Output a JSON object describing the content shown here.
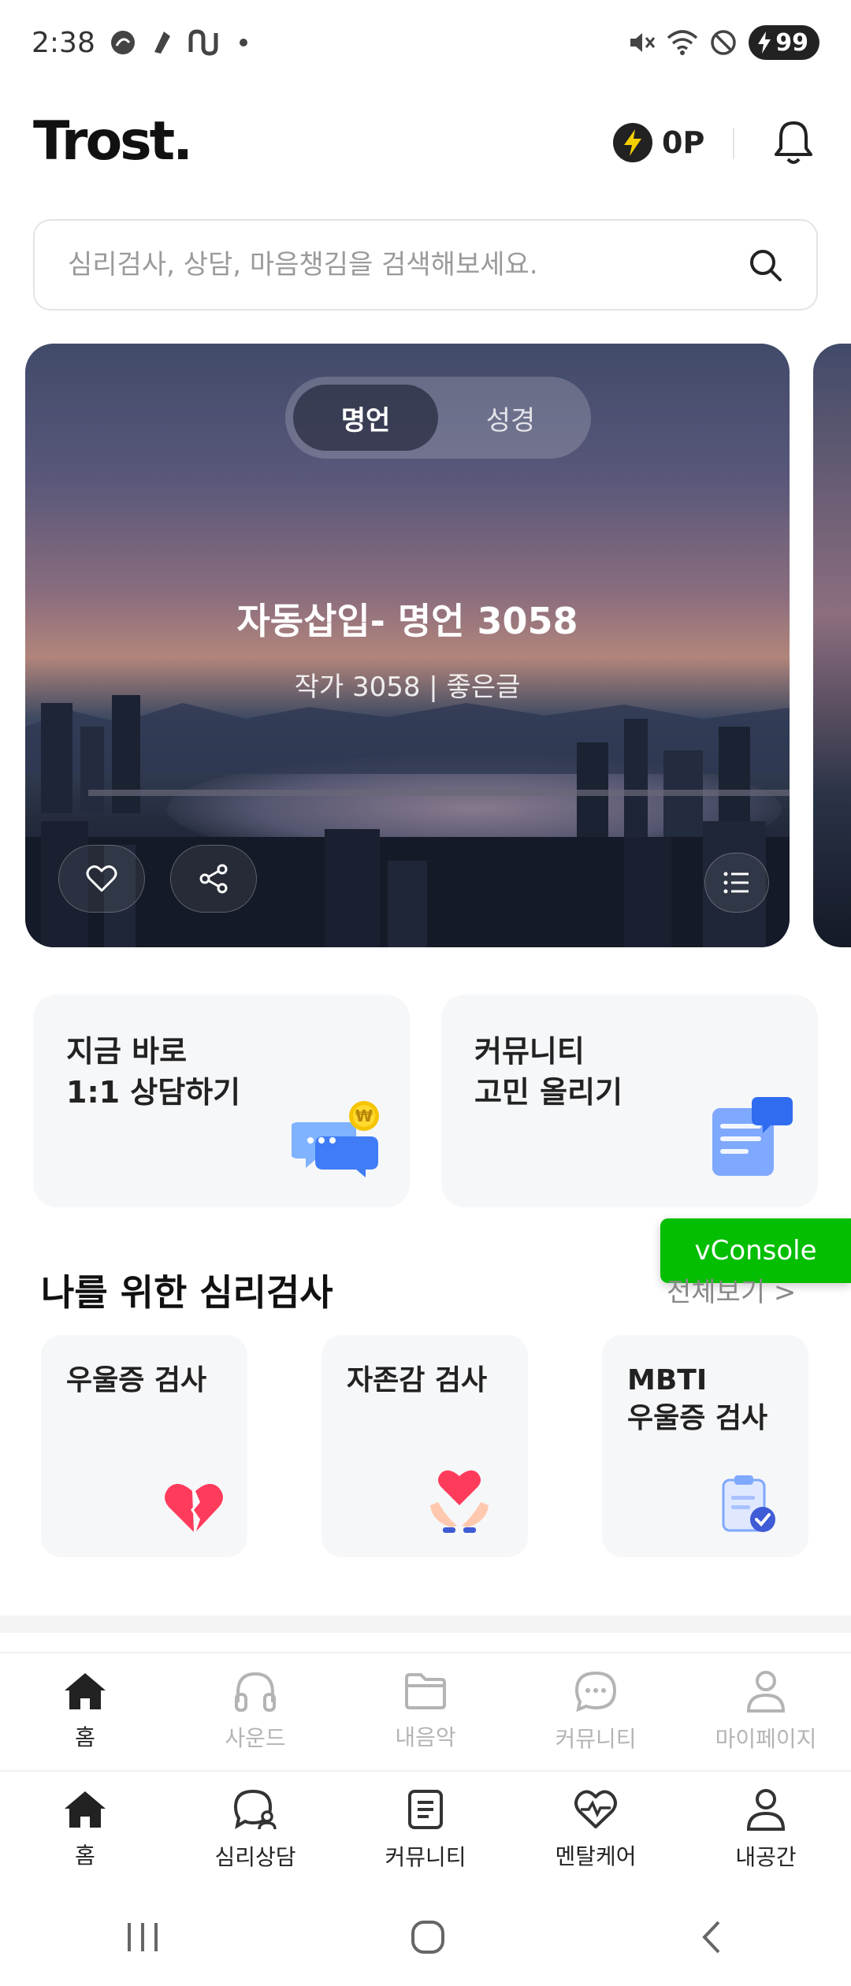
{
  "status_bar": {
    "time": "2:38",
    "battery": "99"
  },
  "header": {
    "logo": "Trost.",
    "points": "0P"
  },
  "search": {
    "placeholder": "심리검사, 상담, 마음챙김을 검색해보세요."
  },
  "hero": {
    "tabs": [
      {
        "label": "명언",
        "active": true
      },
      {
        "label": "성경",
        "active": false
      }
    ],
    "title": "자동삽입- 명언 3058",
    "subtitle": "작가 3058 | 좋은글"
  },
  "quick_actions": [
    {
      "line1": "지금 바로",
      "line2": "1:1 상담하기",
      "icon": "chat-coin-icon"
    },
    {
      "line1": "커뮤니티",
      "line2": "고민 올리기",
      "icon": "note-bubble-icon"
    }
  ],
  "vconsole_label": "vConsole",
  "tests_section": {
    "title": "나를 위한 심리검사",
    "more": "전체보기 >",
    "items": [
      {
        "line1": "우울증 검사",
        "line2": "",
        "icon": "broken-heart-icon"
      },
      {
        "line1": "자존감 검사",
        "line2": "",
        "icon": "heart-hands-icon"
      },
      {
        "line1": "MBTI",
        "line2": "우울증 검사",
        "icon": "clipboard-check-icon"
      }
    ]
  },
  "nav_top": [
    {
      "label": "홈",
      "icon": "home-icon",
      "active": true
    },
    {
      "label": "사운드",
      "icon": "headphones-icon",
      "active": false
    },
    {
      "label": "내음악",
      "icon": "folder-icon",
      "active": false
    },
    {
      "label": "커뮤니티",
      "icon": "chat-icon",
      "active": false
    },
    {
      "label": "마이페이지",
      "icon": "person-icon",
      "active": false
    }
  ],
  "nav_bottom": [
    {
      "label": "홈",
      "icon": "home-icon",
      "active": true
    },
    {
      "label": "심리상담",
      "icon": "counsel-icon",
      "active": false
    },
    {
      "label": "커뮤니티",
      "icon": "document-icon",
      "active": false
    },
    {
      "label": "멘탈케어",
      "icon": "heart-pulse-icon",
      "active": false
    },
    {
      "label": "내공간",
      "icon": "person-icon",
      "active": false
    }
  ],
  "colors": {
    "accent_green": "#04be02",
    "point_yellow": "#f5d000",
    "heart_red": "#ff3b5c",
    "icon_blue": "#3f7cf6"
  }
}
